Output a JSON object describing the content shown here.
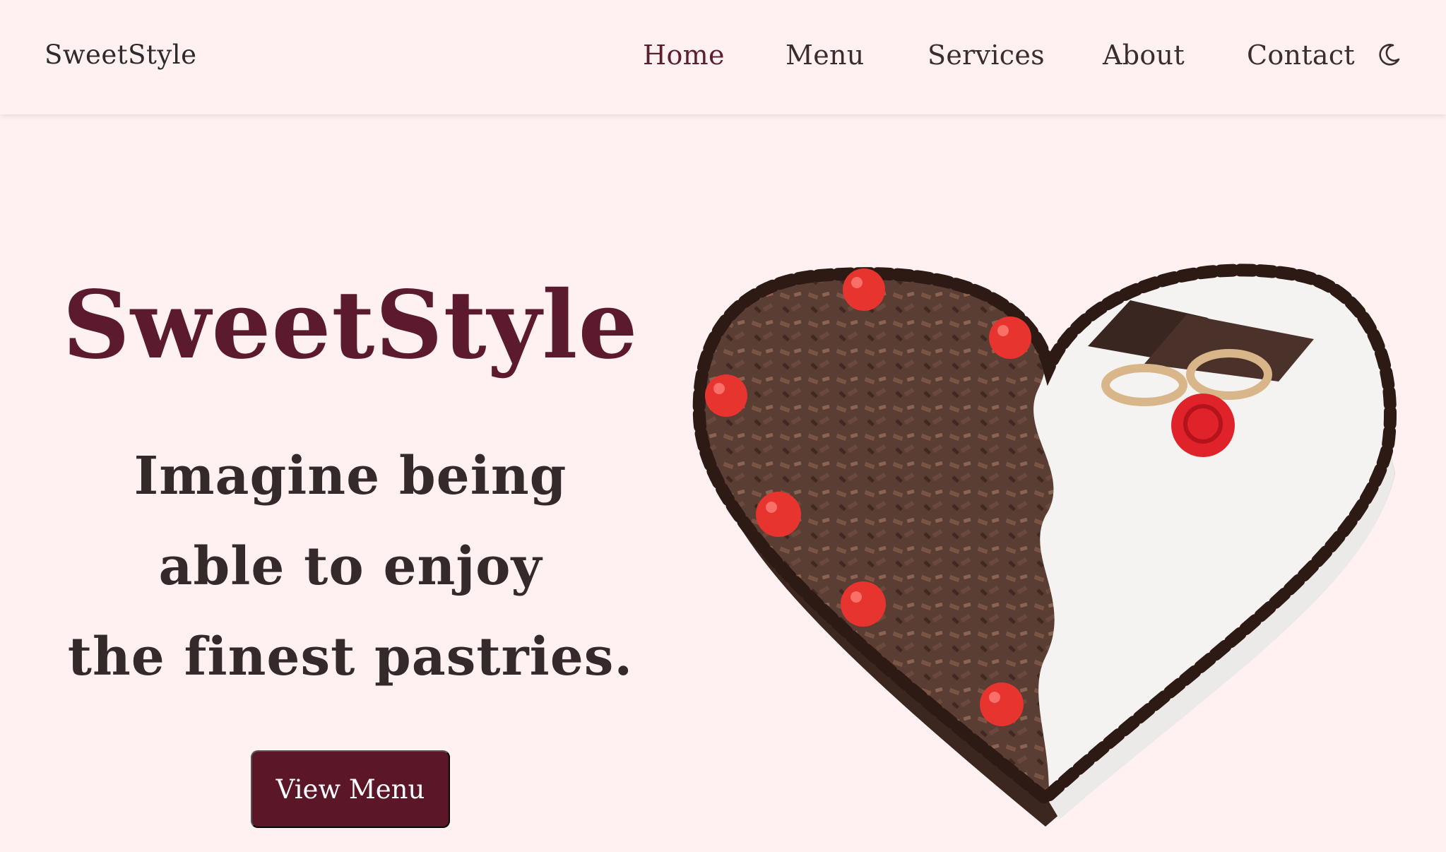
{
  "header": {
    "brand": "SweetStyle",
    "nav": [
      {
        "label": "Home",
        "active": true
      },
      {
        "label": "Menu",
        "active": false
      },
      {
        "label": "Services",
        "active": false
      },
      {
        "label": "About",
        "active": false
      },
      {
        "label": "Contact",
        "active": false
      }
    ],
    "theme_toggle_icon": "moon-icon"
  },
  "hero": {
    "title": "SweetStyle",
    "tagline_lines": [
      "Imagine being",
      "able to enjoy",
      "the finest pastries."
    ],
    "cta_label": "View Menu",
    "image": "heart-shaped-cake"
  },
  "colors": {
    "background": "#fff1f2",
    "accent": "#5b1a2d",
    "text": "#342a2b"
  }
}
